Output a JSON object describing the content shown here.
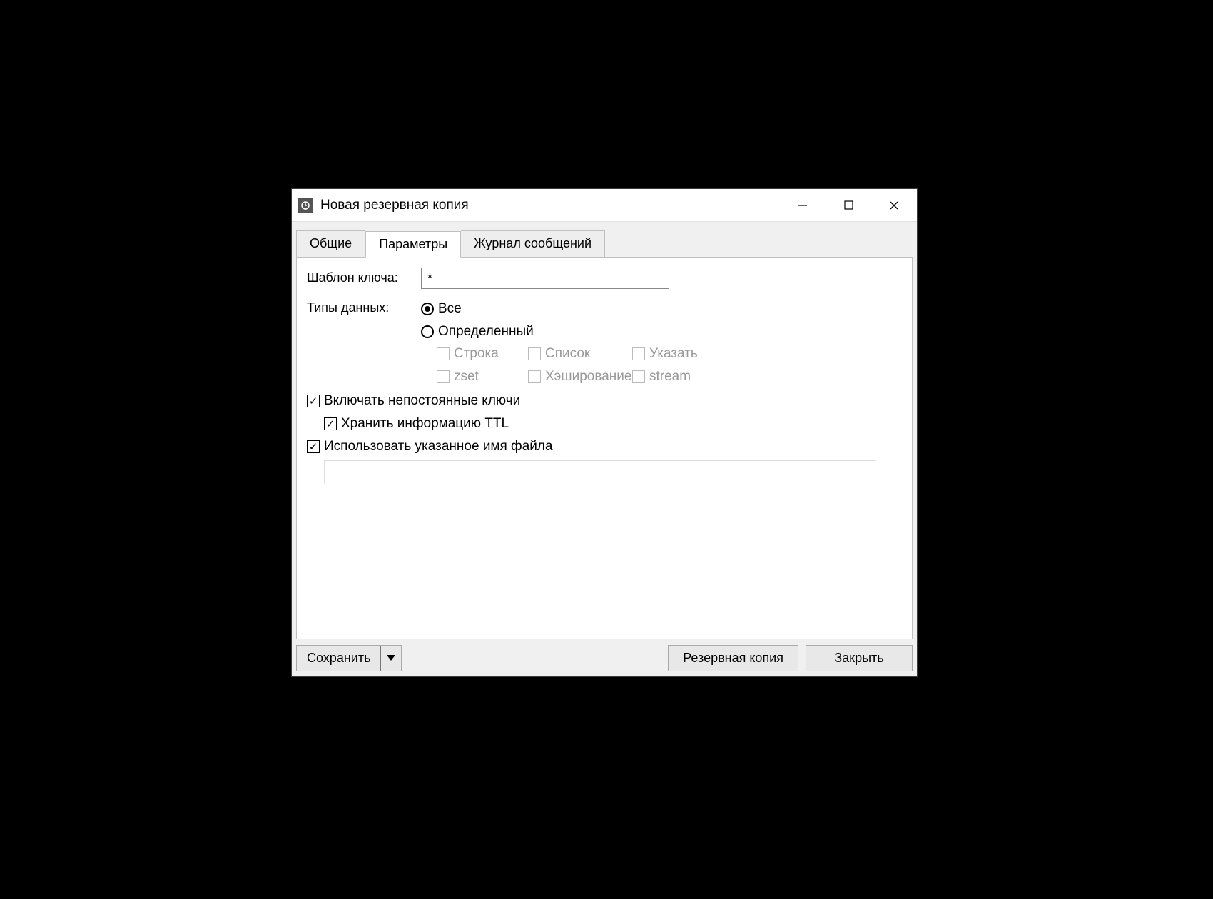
{
  "window": {
    "title": "Новая резервная копия"
  },
  "tabs": {
    "general": "Общие",
    "parameters": "Параметры",
    "log": "Журнал сообщений"
  },
  "labels": {
    "key_pattern": "Шаблон ключа:",
    "data_types": "Типы данных:"
  },
  "key_pattern_value": "*",
  "radio": {
    "all": "Все",
    "specific": "Определенный"
  },
  "types": {
    "string": "Строка",
    "list": "Список",
    "set": "Указать",
    "zset": "zset",
    "hash": "Хэширование",
    "stream": "stream"
  },
  "options": {
    "include_volatile": "Включать непостоянные ключи",
    "store_ttl": "Хранить информацию TTL",
    "use_filename": "Использовать указанное имя файла"
  },
  "filename_value": "",
  "buttons": {
    "save": "Сохранить",
    "backup": "Резервная копия",
    "close": "Закрыть"
  }
}
